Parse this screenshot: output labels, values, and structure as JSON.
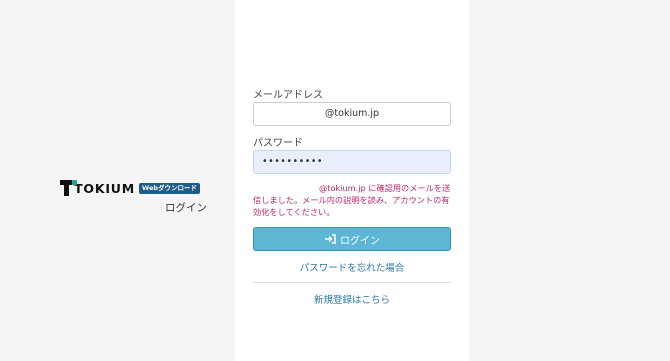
{
  "brand": {
    "logo_text": "TOKIUM",
    "badge": "Webダウンロード",
    "subtitle": "ログイン"
  },
  "form": {
    "email_label": "メールアドレス",
    "email_value": "@tokium.jp",
    "password_label": "パスワード",
    "password_value": "••••••••••",
    "message": "@tokium.jp  に確認用のメールを送信しました。メール内の説明を読み、アカウントの有効化をしてください。",
    "login_button": "ログイン",
    "forgot_link": "パスワードを忘れた場合",
    "register_link": "新規登録はこちら"
  },
  "colors": {
    "accent": "#5bb7d4",
    "error_text": "#c0266b",
    "link": "#2a77a8",
    "brand_badge": "#1f5c87",
    "brand_dot": "#1da59b"
  },
  "icons": {
    "login": "login-arrow-icon"
  }
}
